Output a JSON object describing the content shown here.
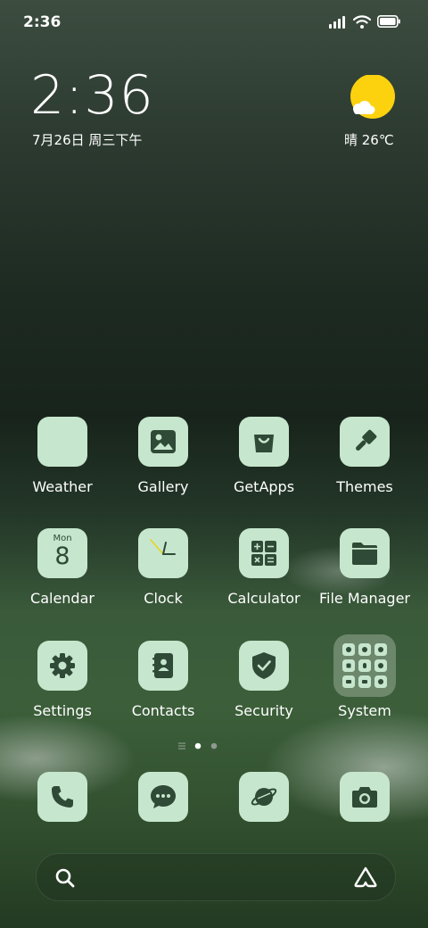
{
  "status_bar": {
    "time": "2:36"
  },
  "clock_widget": {
    "time": "2:36",
    "date": "7月26日 周三下午"
  },
  "weather_widget": {
    "text": "晴 26℃",
    "icon": "sun-partly-cloudy-icon"
  },
  "apps": [
    {
      "label": "Weather",
      "icon": "weather-icon"
    },
    {
      "label": "Gallery",
      "icon": "gallery-icon"
    },
    {
      "label": "GetApps",
      "icon": "shopping-bag-icon"
    },
    {
      "label": "Themes",
      "icon": "paintbrush-icon"
    },
    {
      "label": "Calendar",
      "icon": "calendar-icon",
      "day": "Mon",
      "date": "8"
    },
    {
      "label": "Clock",
      "icon": "clock-icon"
    },
    {
      "label": "Calculator",
      "icon": "calculator-icon"
    },
    {
      "label": "File Manager",
      "icon": "folder-icon"
    },
    {
      "label": "Settings",
      "icon": "gear-icon"
    },
    {
      "label": "Contacts",
      "icon": "contacts-book-icon"
    },
    {
      "label": "Security",
      "icon": "shield-check-icon"
    },
    {
      "label": "System",
      "icon": "folder-grid-icon"
    }
  ],
  "dock": [
    {
      "icon": "phone-icon"
    },
    {
      "icon": "message-icon"
    },
    {
      "icon": "browser-planet-icon"
    },
    {
      "icon": "camera-icon"
    }
  ],
  "pager": {
    "pages": 3,
    "current": 2
  },
  "colors": {
    "icon_bg": "#c6e6cd",
    "icon_fg": "#2f4a36",
    "sun": "#fcd20e"
  }
}
